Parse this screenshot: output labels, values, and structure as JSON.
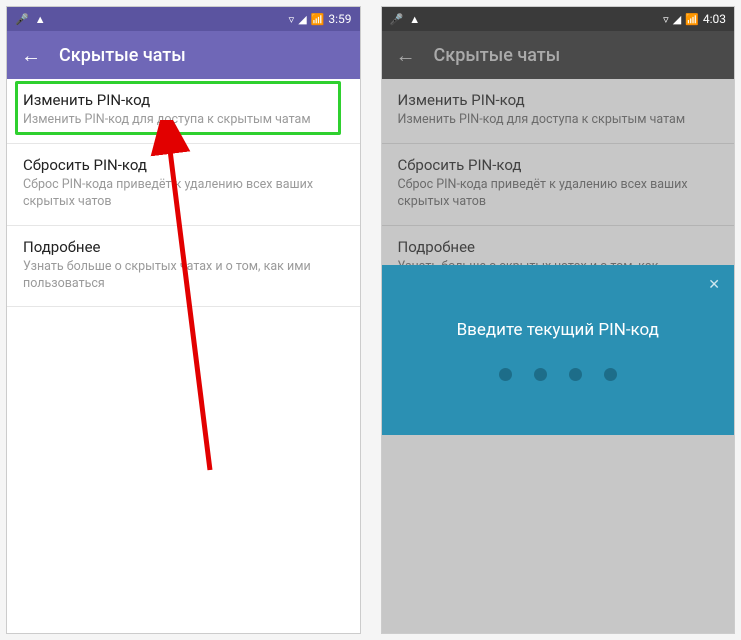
{
  "left": {
    "status": {
      "time": "3:59",
      "wifi": "▾",
      "battery": "▮",
      "mic": "✪",
      "debug": "⊕"
    },
    "appbar": {
      "title": "Скрытые чаты"
    },
    "items": [
      {
        "title": "Изменить PIN-код",
        "sub": "Изменить PIN-код для доступа к скрытым чатам"
      },
      {
        "title": "Сбросить PIN-код",
        "sub": "Сброс PIN-кода приведёт к удалению всех ваших скрытых чатов"
      },
      {
        "title": "Подробнее",
        "sub": "Узнать больше о скрытых чатах и о том, как ими пользоваться"
      }
    ]
  },
  "right": {
    "status": {
      "time": "4:03"
    },
    "appbar": {
      "title": "Скрытые чаты"
    },
    "items": [
      {
        "title": "Изменить PIN-код",
        "sub": "Изменить PIN-код для доступа к скрытым чатам"
      },
      {
        "title": "Сбросить PIN-код",
        "sub": "Сброс PIN-кода приведёт к удалению всех ваших скрытых чатов"
      },
      {
        "title": "Подробнее",
        "sub": "Узнать больше о скрытых чатах и о том, как"
      }
    ],
    "pin": {
      "prompt": "Введите текущий PIN-код",
      "digits": 4
    }
  }
}
